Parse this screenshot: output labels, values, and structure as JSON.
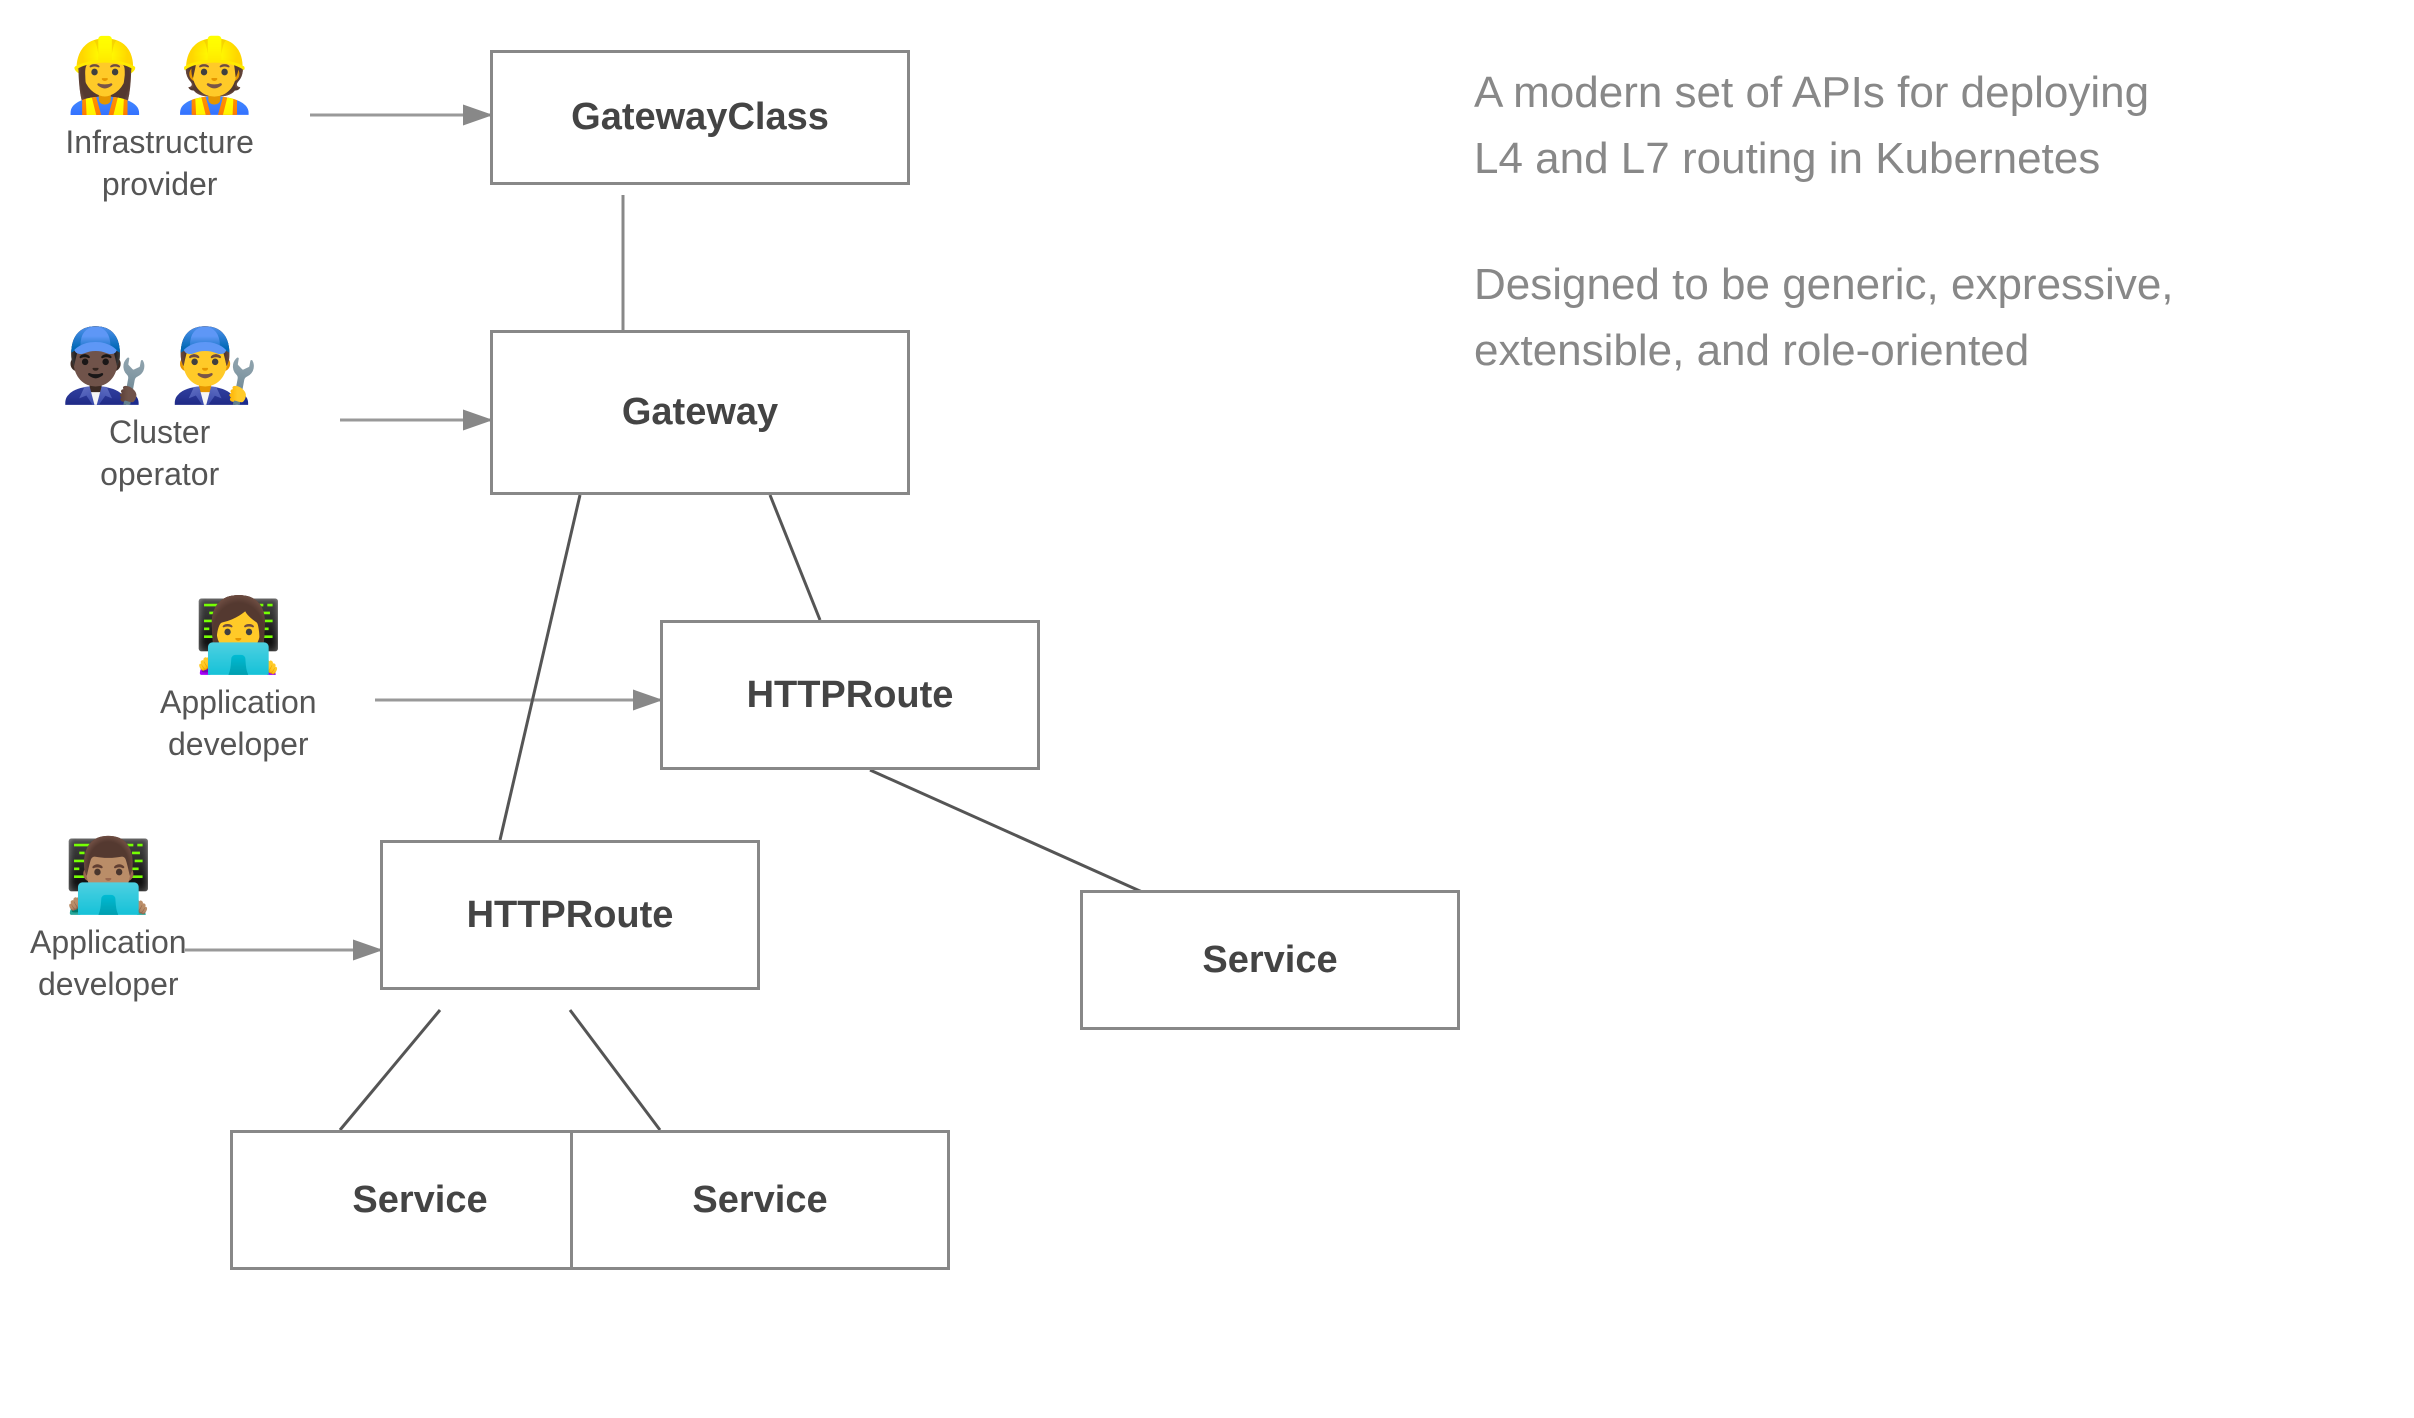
{
  "diagram": {
    "boxes": {
      "gatewayclass": {
        "label": "GatewayClass"
      },
      "gateway": {
        "label": "Gateway"
      },
      "httproute_top": {
        "label": "HTTPRoute"
      },
      "httproute_bottom": {
        "label": "HTTPRoute"
      },
      "service_right": {
        "label": "Service"
      },
      "service_left": {
        "label": "Service"
      },
      "service_center": {
        "label": "Service"
      }
    },
    "persons": {
      "infra_provider": {
        "emojis": [
          "👷‍♀️",
          "👷"
        ],
        "label": "Infrastructure\nprovider"
      },
      "cluster_operator": {
        "emojis": [
          "👨🏿‍🔧",
          "👨‍🔧"
        ],
        "label": "Cluster\noperator"
      },
      "app_dev_top": {
        "emojis": [
          "👩‍💻"
        ],
        "label": "Application\ndeveloper"
      },
      "app_dev_bottom": {
        "emojis": [
          "👨🏽‍💻"
        ],
        "label": "Application\ndeveloper"
      }
    },
    "info": {
      "line1": "A modern set of APIs for deploying\nL4 and L7 routing in Kubernetes",
      "line2": "Designed to be generic, expressive,\nextensible, and role-oriented"
    }
  }
}
